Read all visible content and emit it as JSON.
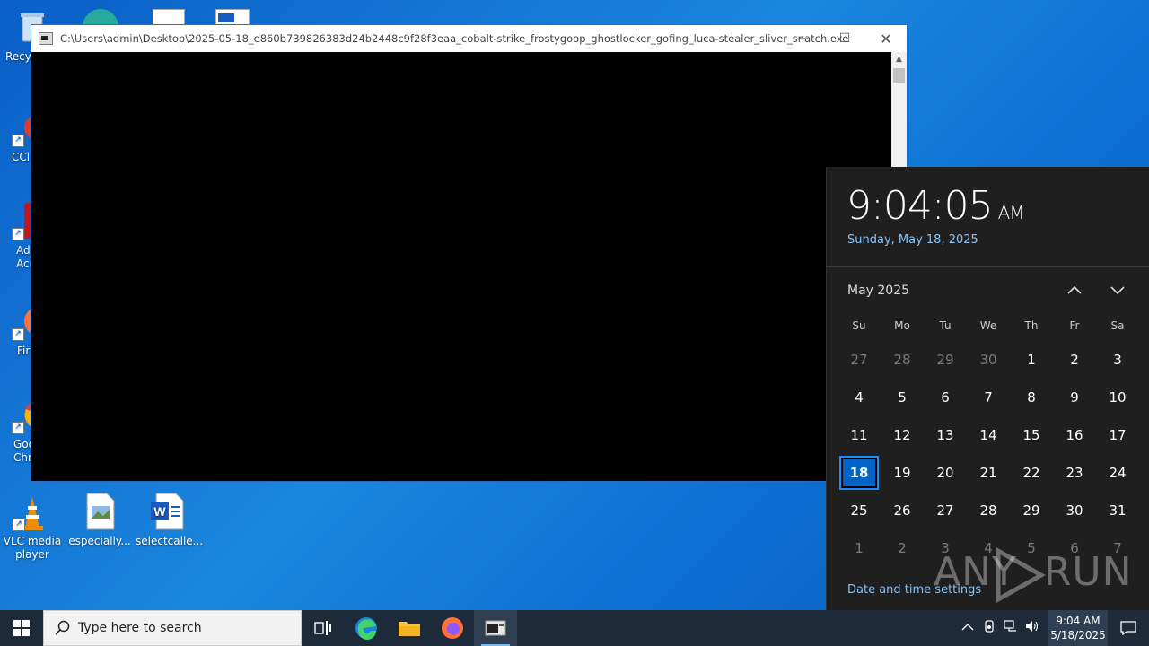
{
  "desktop": {
    "icons": [
      {
        "label": "Recy",
        "name": "recycle-bin"
      },
      {
        "label": "CCl",
        "name": "ccleaner"
      },
      {
        "label": "Ad\nAcr",
        "name": "adobe-acrobat"
      },
      {
        "label": "Fir",
        "name": "firefox"
      },
      {
        "label": "Goo\nChr",
        "name": "google-chrome"
      },
      {
        "label": "VLC media player",
        "name": "vlc-media-player"
      },
      {
        "label": "especially...",
        "name": "especially-file"
      },
      {
        "label": "selectcalle...",
        "name": "selectcalle-file"
      }
    ]
  },
  "window": {
    "title": "C:\\Users\\admin\\Desktop\\2025-05-18_e860b739826383d24b2448c9f28f3eaa_cobalt-strike_frostygoop_ghostlocker_gofing_luca-stealer_sliver_snatch.exe",
    "minimize": "—",
    "maximize": "☐",
    "close": "✕"
  },
  "flyout": {
    "time": "9:04:05",
    "ampm": "AM",
    "date_long": "Sunday, May 18, 2025",
    "month_label": "May 2025",
    "prev": "︿",
    "next": "﹀",
    "weekdays": [
      "Su",
      "Mo",
      "Tu",
      "We",
      "Th",
      "Fr",
      "Sa"
    ],
    "weeks": [
      [
        "27",
        "28",
        "29",
        "30",
        "1",
        "2",
        "3"
      ],
      [
        "4",
        "5",
        "6",
        "7",
        "8",
        "9",
        "10"
      ],
      [
        "11",
        "12",
        "13",
        "14",
        "15",
        "16",
        "17"
      ],
      [
        "18",
        "19",
        "20",
        "21",
        "22",
        "23",
        "24"
      ],
      [
        "25",
        "26",
        "27",
        "28",
        "29",
        "30",
        "31"
      ],
      [
        "1",
        "2",
        "3",
        "4",
        "5",
        "6",
        "7"
      ]
    ],
    "selected_day": "18",
    "settings_link": "Date and time settings"
  },
  "watermark": "ANY  RUN",
  "taskbar": {
    "search_placeholder": "Type here to search",
    "clock_time": "9:04 AM",
    "clock_date": "5/18/2025"
  },
  "colors": {
    "accent": "#0063c5",
    "link": "#8bc2f6",
    "flyout_bg": "#1f1f1f",
    "taskbar_bg": "#1c2a3a"
  }
}
